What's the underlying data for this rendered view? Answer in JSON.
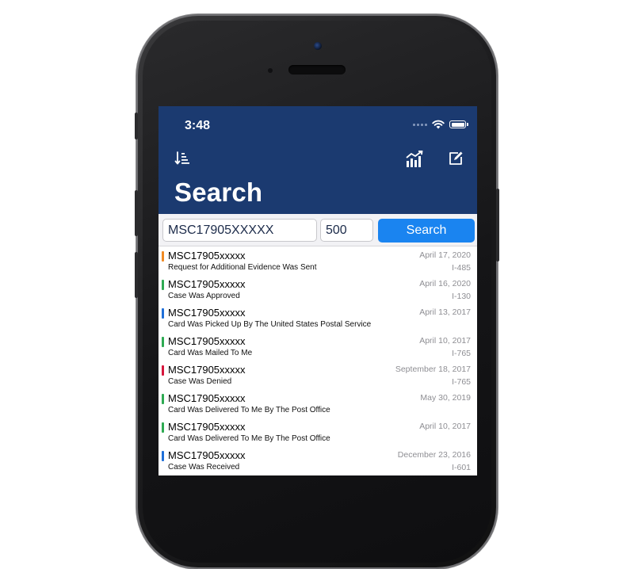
{
  "status_bar": {
    "time": "3:48"
  },
  "header": {
    "title": "Search"
  },
  "search": {
    "receipt_value": "MSC17905XXXXX",
    "count_value": "500",
    "button_label": "Search"
  },
  "colors": {
    "navbar": "#1b3a70",
    "accent": "#1a84f0",
    "status_rfe": "#f08a24",
    "status_approved": "#2eaa52",
    "status_info": "#1f6fd8",
    "status_denied": "#d6163c"
  },
  "cases": [
    {
      "receipt": "MSC17905xxxxx",
      "status": "Request for Additional Evidence Was Sent",
      "date": "April 17, 2020",
      "form": "I-485",
      "color": "#f08a24"
    },
    {
      "receipt": "MSC17905xxxxx",
      "status": "Case Was Approved",
      "date": "April 16, 2020",
      "form": "I-130",
      "color": "#2eaa52"
    },
    {
      "receipt": "MSC17905xxxxx",
      "status": "Card Was Picked Up By The United States Postal Service",
      "date": "April 13, 2017",
      "form": "",
      "color": "#1f6fd8"
    },
    {
      "receipt": "MSC17905xxxxx",
      "status": "Card Was Mailed To Me",
      "date": "April 10, 2017",
      "form": "I-765",
      "color": "#2eaa52"
    },
    {
      "receipt": "MSC17905xxxxx",
      "status": "Case Was Denied",
      "date": "September 18, 2017",
      "form": "I-765",
      "color": "#d6163c"
    },
    {
      "receipt": "MSC17905xxxxx",
      "status": "Card Was Delivered To Me By The Post Office",
      "date": "May 30, 2019",
      "form": "",
      "color": "#2eaa52"
    },
    {
      "receipt": "MSC17905xxxxx",
      "status": "Card Was Delivered To Me By The Post Office",
      "date": "April 10, 2017",
      "form": "",
      "color": "#2eaa52"
    },
    {
      "receipt": "MSC17905xxxxx",
      "status": "Case Was Received",
      "date": "December 23, 2016",
      "form": "I-601",
      "color": "#1f6fd8"
    }
  ],
  "icons": {
    "sort": "sort-icon",
    "chart": "chart-icon",
    "compose": "compose-icon"
  }
}
